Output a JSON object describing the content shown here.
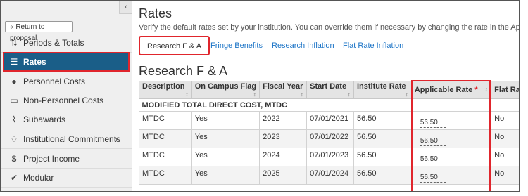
{
  "sidebar": {
    "collapse_icon": "‹",
    "return_button": "« Return to proposal",
    "items": [
      {
        "label": "Periods & Totals",
        "icon": "sort-icon"
      },
      {
        "label": "Rates",
        "icon": "rates-icon",
        "active": true
      },
      {
        "label": "Personnel Costs",
        "icon": "person-icon"
      },
      {
        "label": "Non-Personnel Costs",
        "icon": "document-icon"
      },
      {
        "label": "Subawards",
        "icon": "paperclip-icon"
      },
      {
        "label": "Institutional Commitments",
        "icon": "bell-icon",
        "chevron": "›"
      },
      {
        "label": "Project Income",
        "icon": "dollar-icon"
      },
      {
        "label": "Modular",
        "icon": "check-icon"
      }
    ]
  },
  "main": {
    "title": "Rates",
    "subtitle": "Verify the default rates set by your institution. You can override them if necessary by changing the rate in the Applicable Rate col",
    "tabs": [
      {
        "label": "Research F & A",
        "active": true
      },
      {
        "label": "Fringe Benefits"
      },
      {
        "label": "Research Inflation"
      },
      {
        "label": "Flat Rate Inflation"
      }
    ],
    "section_title": "Research F & A",
    "table": {
      "headers": [
        "Description",
        "On Campus Flag",
        "Fiscal Year",
        "Start Date",
        "Institute Rate",
        "Applicable Rate",
        "Flat Rate"
      ],
      "required_mark": "*",
      "sort_icon": "↕",
      "group_label": "MODIFIED TOTAL DIRECT COST, MTDC",
      "rows": [
        {
          "description": "MTDC",
          "on_campus": "Yes",
          "fiscal_year": "2022",
          "start_date": "07/01/2021",
          "institute_rate": "56.50",
          "applicable_rate": "56.50",
          "flat_rate": "No"
        },
        {
          "description": "MTDC",
          "on_campus": "Yes",
          "fiscal_year": "2023",
          "start_date": "07/01/2022",
          "institute_rate": "56.50",
          "applicable_rate": "56.50",
          "flat_rate": "No"
        },
        {
          "description": "MTDC",
          "on_campus": "Yes",
          "fiscal_year": "2024",
          "start_date": "07/01/2023",
          "institute_rate": "56.50",
          "applicable_rate": "56.50",
          "flat_rate": "No"
        },
        {
          "description": "MTDC",
          "on_campus": "Yes",
          "fiscal_year": "2025",
          "start_date": "07/01/2024",
          "institute_rate": "56.50",
          "applicable_rate": "56.50",
          "flat_rate": "No"
        }
      ]
    }
  }
}
